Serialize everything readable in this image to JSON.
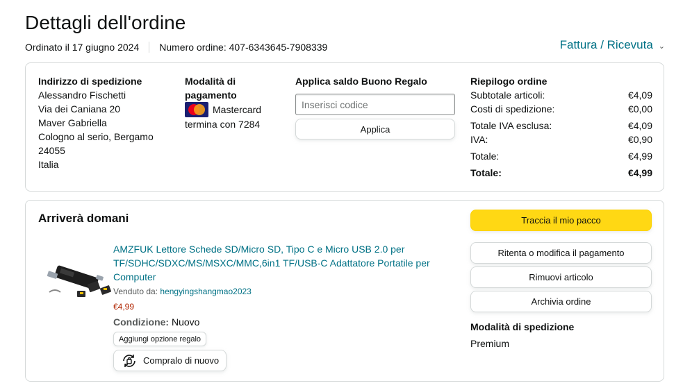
{
  "header": {
    "title": "Dettagli dell'ordine",
    "order_date": "Ordinato il 17 giugno 2024",
    "order_number": "Numero ordine: 407-6343645-7908339",
    "invoice_link": "Fattura / Ricevuta"
  },
  "shipping_address": {
    "heading": "Indirizzo di spedizione",
    "lines": [
      "Alessandro Fischetti",
      "Via dei Caniana 20",
      "Maver Gabriella",
      "Cologno al serio, Bergamo",
      "24055",
      "Italia"
    ]
  },
  "payment": {
    "heading": "Modalità di pagamento",
    "card_brand": "Mastercard",
    "card_ending": "termina con 7284",
    "card_icon": "mastercard-icon"
  },
  "gift_card": {
    "heading": "Applica saldo Buono Regalo",
    "input_placeholder": "Inserisci codice",
    "input_value": "",
    "apply_label": "Applica"
  },
  "summary": {
    "heading": "Riepilogo ordine",
    "rows": [
      {
        "label": "Subtotale articoli:",
        "value": "€4,09"
      },
      {
        "label": "Costi di spedizione:",
        "value": "€0,00"
      },
      {
        "label": "Totale IVA esclusa:",
        "value": "€4,09"
      },
      {
        "label": "IVA:",
        "value": "€0,90"
      },
      {
        "label": "Totale:",
        "value": "€4,99"
      },
      {
        "label": "Totale:",
        "value": "€4,99"
      }
    ]
  },
  "shipment": {
    "heading": "Arriverà domani",
    "product": {
      "title": "AMZFUK Lettore Schede SD/Micro SD, Tipo C e Micro USB 2.0 per TF/SDHC/SDXC/MS/MSXC/MMC,6in1 TF/USB-C Adattatore Portatile per Computer",
      "sold_by_label": "Venduto da:",
      "seller": "hengyingshangmao2023",
      "price": "€4,99",
      "condition_label": "Condizione:",
      "condition_value": "Nuovo",
      "gift_option_label": "Aggiungi opzione regalo",
      "buy_again_label": "Compralo di nuovo",
      "buy_again_icon": "buy-again-icon"
    },
    "actions": {
      "track": "Traccia il mio pacco",
      "retry_payment": "Ritenta o modifica il pagamento",
      "remove_items": "Rimuovi articolo",
      "archive": "Archivia ordine"
    },
    "shipping_method_heading": "Modalità di spedizione",
    "shipping_method_value": "Premium"
  },
  "colors": {
    "link": "#007185",
    "track_button": "#FFD814",
    "price": "#B12704",
    "border": "#D5D9D9"
  }
}
